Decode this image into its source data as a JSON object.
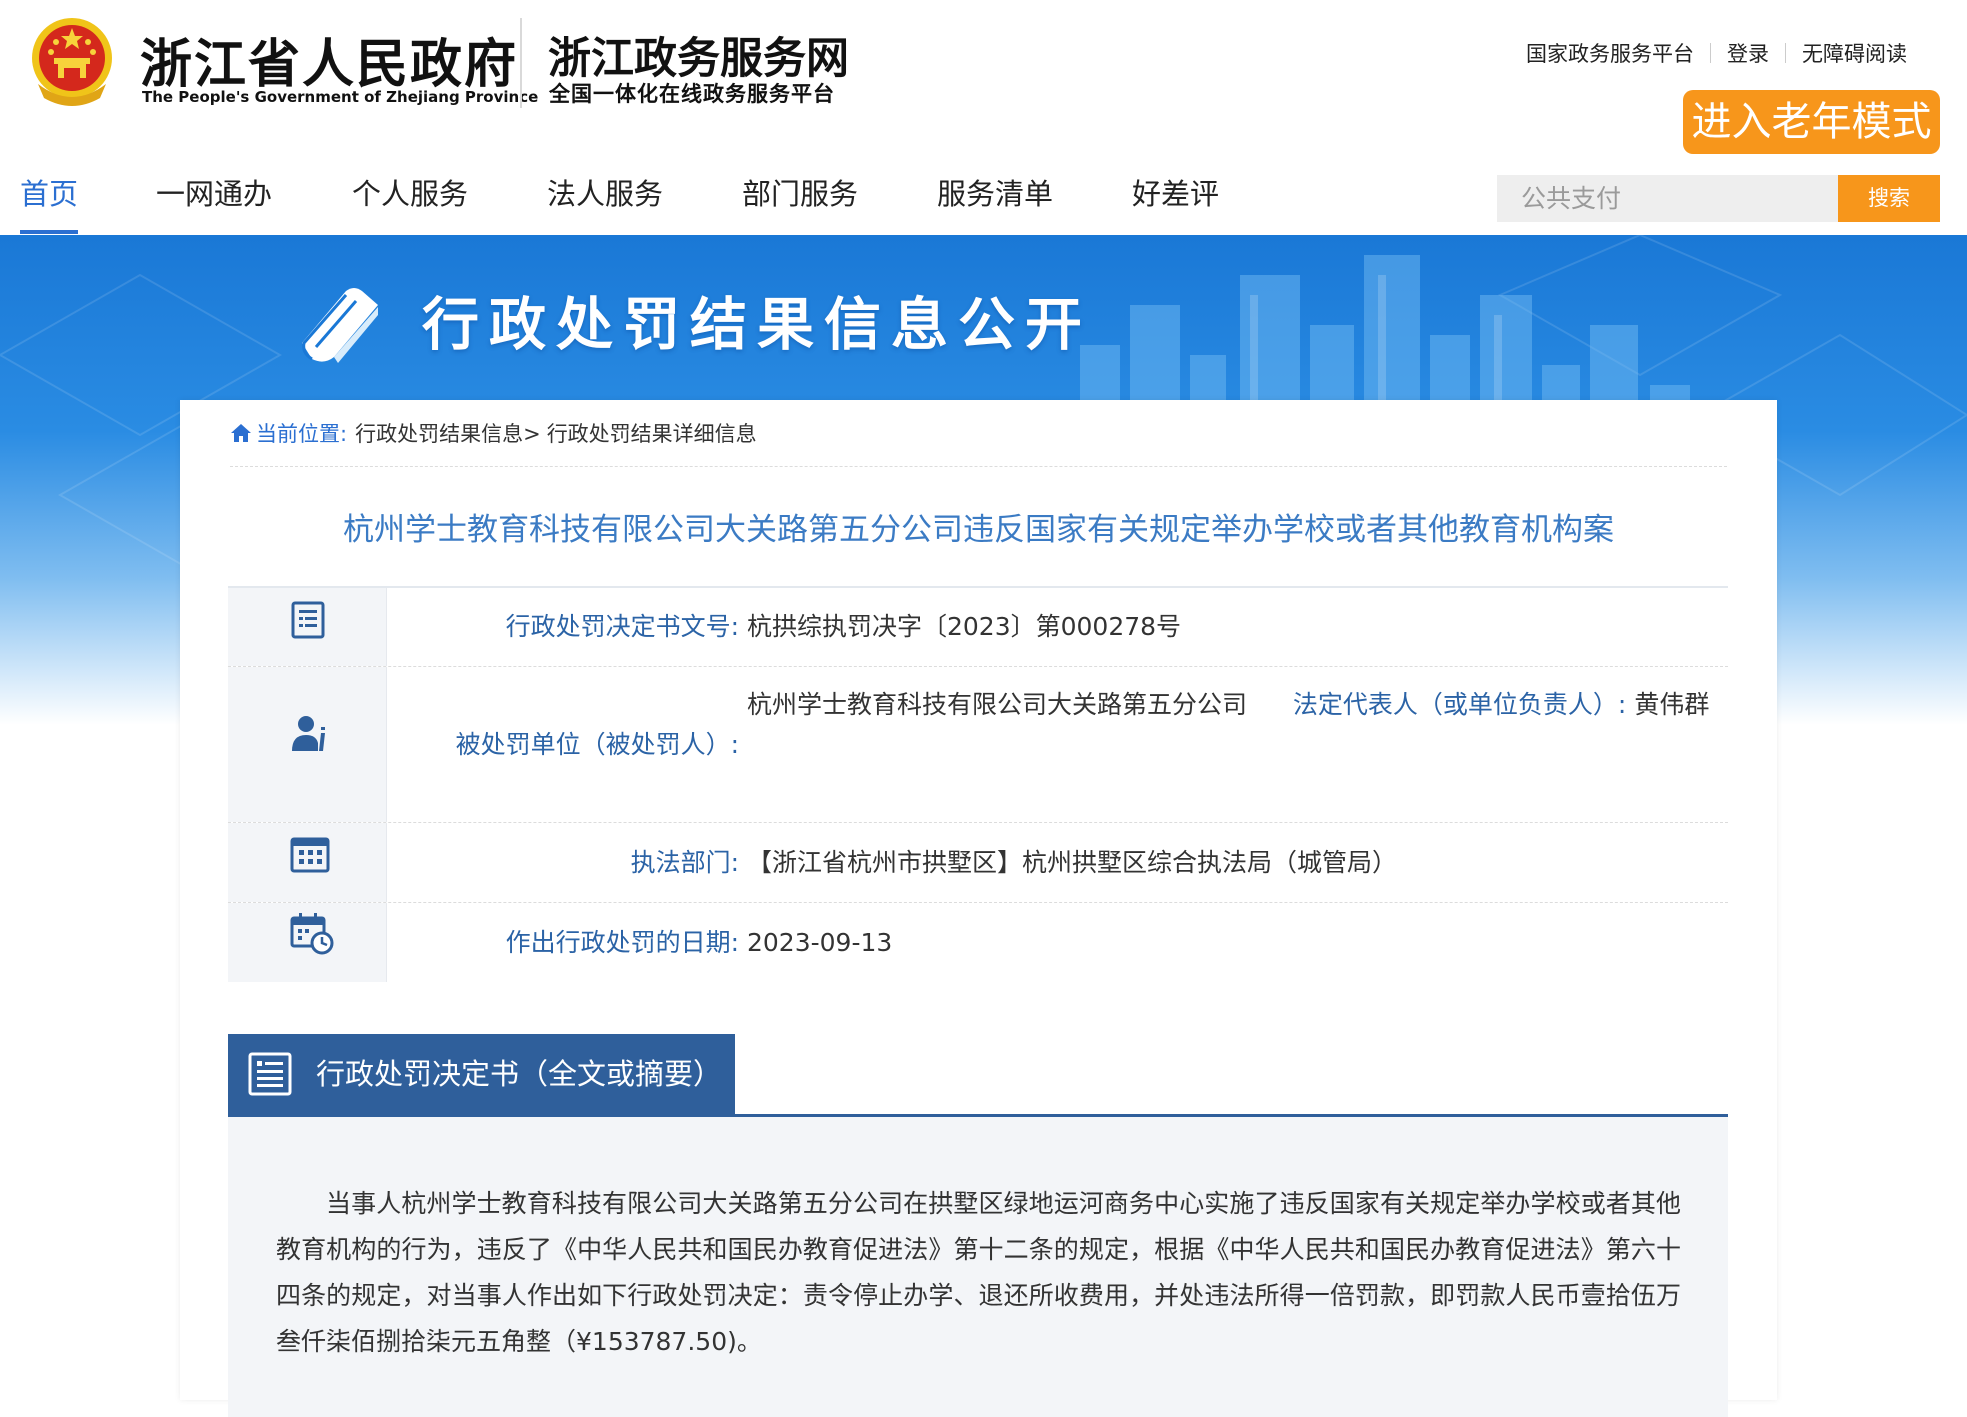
{
  "header": {
    "gov_name_cn": "浙江省人民政府",
    "gov_name_en": "The People's Government of Zhejiang Province",
    "service_name": "浙江政务服务网",
    "service_subtitle": "全国一体化在线政务服务平台",
    "top_links": [
      "国家政务服务平台",
      "登录",
      "无障碍阅读"
    ],
    "elder_mode_label": "进入老年模式",
    "nav": [
      {
        "label": "首页",
        "active": true
      },
      {
        "label": "一网通办",
        "active": false
      },
      {
        "label": "个人服务",
        "active": false
      },
      {
        "label": "法人服务",
        "active": false
      },
      {
        "label": "部门服务",
        "active": false
      },
      {
        "label": "服务清单",
        "active": false
      },
      {
        "label": "好差评",
        "active": false
      }
    ],
    "search": {
      "placeholder": "公共支付",
      "button_label": "搜索"
    }
  },
  "banner": {
    "title": "行政处罚结果信息公开"
  },
  "breadcrumb": {
    "label": "当前位置:",
    "items": [
      "行政处罚结果信息>",
      "行政处罚结果详细信息"
    ]
  },
  "case_title": "杭州学士教育科技有限公司大关路第五分公司违反国家有关规定举办学校或者其他教育机构案",
  "info": {
    "decision_no": {
      "label": "行政处罚决定书文号:",
      "value": "杭拱综执罚决字〔2023〕第000278号"
    },
    "punished": {
      "label": "被处罚单位（被处罚人）:",
      "name": "杭州学士教育科技有限公司大关路第五分公司",
      "rep_label": "法定代表人（或单位负责人）:",
      "rep_value": "黄伟群"
    },
    "department": {
      "label": "执法部门:",
      "value": "【浙江省杭州市拱墅区】杭州拱墅区综合执法局（城管局）"
    },
    "date": {
      "label": "作出行政处罚的日期:",
      "value": "2023-09-13"
    }
  },
  "decision_section": {
    "title": "行政处罚决定书（全文或摘要）",
    "text": "当事人杭州学士教育科技有限公司大关路第五分公司在拱墅区绿地运河商务中心实施了违反国家有关规定举办学校或者其他教育机构的行为，违反了《中华人民共和国民办教育促进法》第十二条的规定，根据《中华人民共和国民办教育促进法》第六十四条的规定，对当事人作出如下行政处罚决定：责令停止办学、退还所收费用，并处违法所得一倍罚款，即罚款人民币壹拾伍万叁仟柒佰捌拾柒元五角整（¥153787.50)。"
  },
  "colors": {
    "accent": "#2b6fd1",
    "orange": "#f7961b",
    "section_blue": "#2f5f9b",
    "title_blue": "#3b7bc4"
  }
}
